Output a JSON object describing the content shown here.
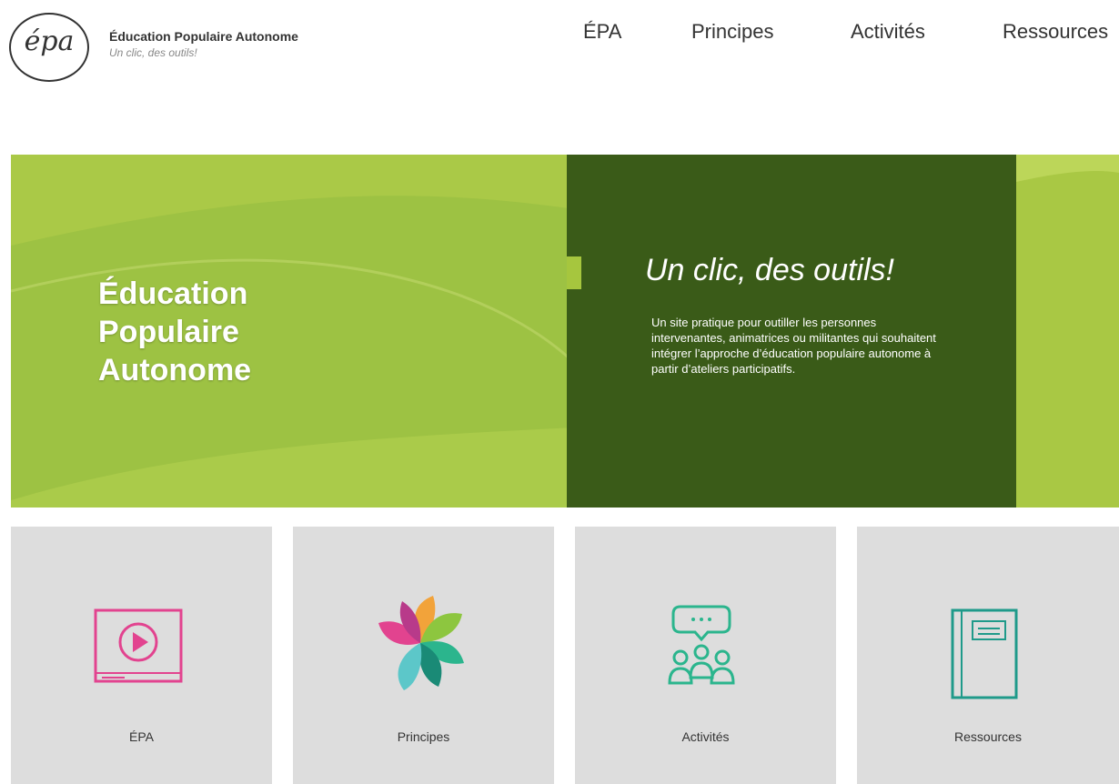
{
  "header": {
    "logo_text": "épa",
    "site_title": "Éducation Populaire Autonome",
    "tagline": "Un clic, des outils!"
  },
  "nav": {
    "items": [
      "ÉPA",
      "Principes",
      "Activités",
      "Ressources"
    ]
  },
  "hero": {
    "title_lines": [
      "Éducation",
      "Populaire",
      "Autonome"
    ],
    "panel_heading": "Un clic, des outils!",
    "panel_body": "Un site pratique pour outiller les personnes intervenantes, animatrices ou militantes qui souhaitent intégrer l’approche d’éducation populaire autonome à partir d’ateliers participatifs."
  },
  "cards": [
    {
      "label": "ÉPA",
      "icon": "video-play-icon",
      "color": "#e2438f"
    },
    {
      "label": "Principes",
      "icon": "pinwheel-icon",
      "color": "#f2a33a"
    },
    {
      "label": "Activités",
      "icon": "group-discussion-icon",
      "color": "#2bb58d"
    },
    {
      "label": "Ressources",
      "icon": "notebook-icon",
      "color": "#1f9a8a"
    }
  ],
  "colors": {
    "hero_green": "#9dc243",
    "panel_green": "#3a5b18",
    "card_bg": "#dddddd"
  }
}
